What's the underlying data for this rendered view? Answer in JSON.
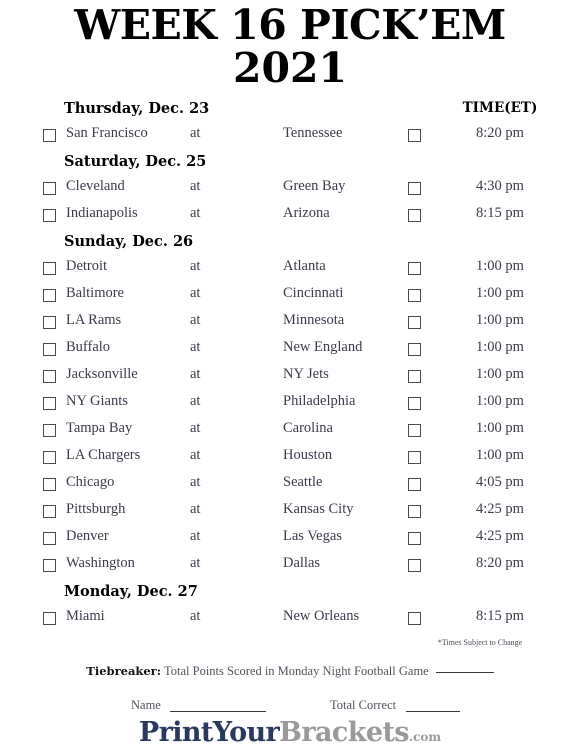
{
  "title": {
    "line1": "WEEK 16 PICK’EM",
    "line2": "2021"
  },
  "columns": {
    "time_header": "TIME(ET)",
    "at_label": "at"
  },
  "days": [
    {
      "label": "Thursday, Dec. 23",
      "games": [
        {
          "away": "San Francisco",
          "at": "at",
          "home": "Tennessee",
          "time": "8:20 pm"
        }
      ]
    },
    {
      "label": "Saturday, Dec. 25",
      "games": [
        {
          "away": "Cleveland",
          "at": "at",
          "home": "Green Bay",
          "time": "4:30 pm"
        },
        {
          "away": "Indianapolis",
          "at": "at",
          "home": "Arizona",
          "time": "8:15 pm"
        }
      ]
    },
    {
      "label": "Sunday, Dec. 26",
      "games": [
        {
          "away": "Detroit",
          "at": "at",
          "home": "Atlanta",
          "time": "1:00 pm"
        },
        {
          "away": "Baltimore",
          "at": "at",
          "home": "Cincinnati",
          "time": "1:00 pm"
        },
        {
          "away": "LA Rams",
          "at": "at",
          "home": "Minnesota",
          "time": "1:00 pm"
        },
        {
          "away": "Buffalo",
          "at": "at",
          "home": "New England",
          "time": "1:00 pm"
        },
        {
          "away": "Jacksonville",
          "at": "at",
          "home": "NY Jets",
          "time": "1:00 pm"
        },
        {
          "away": "NY Giants",
          "at": "at",
          "home": "Philadelphia",
          "time": "1:00 pm"
        },
        {
          "away": "Tampa Bay",
          "at": "at",
          "home": "Carolina",
          "time": "1:00 pm"
        },
        {
          "away": "LA Chargers",
          "at": "at",
          "home": "Houston",
          "time": "1:00 pm"
        },
        {
          "away": "Chicago",
          "at": "at",
          "home": "Seattle",
          "time": "4:05 pm"
        },
        {
          "away": "Pittsburgh",
          "at": "at",
          "home": "Kansas City",
          "time": "4:25 pm"
        },
        {
          "away": "Denver",
          "at": "at",
          "home": "Las Vegas",
          "time": "4:25 pm"
        },
        {
          "away": "Washington",
          "at": "at",
          "home": "Dallas",
          "time": "8:20 pm"
        }
      ]
    },
    {
      "label": "Monday, Dec. 27",
      "games": [
        {
          "away": "Miami",
          "at": "at",
          "home": "New Orleans",
          "time": "8:15 pm"
        }
      ]
    }
  ],
  "footer": {
    "fine_print": "*Times Subject to Change",
    "tiebreaker_label": "Tiebreaker:",
    "tiebreaker_text": "Total Points Scored in Monday Night Football Game",
    "name_label": "Name",
    "total_correct_label": "Total Correct"
  },
  "logo": {
    "part1": "PrintYour",
    "part2": "Brackets",
    "part3": ".com",
    "color_navy": "#2a3a5e",
    "color_gray": "#9a9a9a"
  }
}
